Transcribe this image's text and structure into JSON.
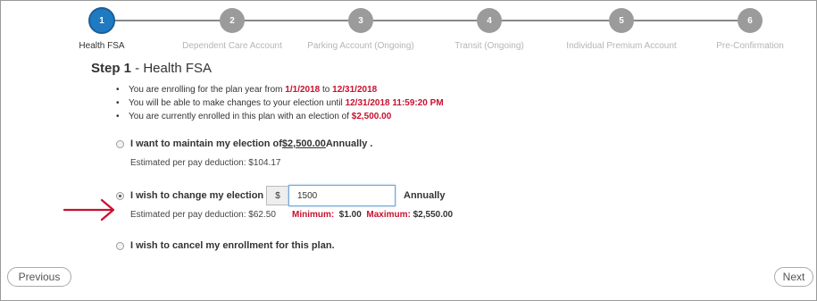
{
  "stepper": {
    "steps": [
      {
        "number": "1",
        "label": "Health FSA",
        "active": true
      },
      {
        "number": "2",
        "label": "Dependent Care Account",
        "active": false
      },
      {
        "number": "3",
        "label": "Parking Account (Ongoing)",
        "active": false
      },
      {
        "number": "4",
        "label": "Transit (Ongoing)",
        "active": false
      },
      {
        "number": "5",
        "label": "Individual Premium Account",
        "active": false
      },
      {
        "number": "6",
        "label": "Pre-Confirmation",
        "active": false
      }
    ]
  },
  "heading": {
    "step": "Step 1",
    "title": " - Health FSA"
  },
  "info": {
    "line1_prefix": "You are enrolling for the plan year from ",
    "line1_start": "1/1/2018",
    "line1_mid": " to ",
    "line1_end": "12/31/2018",
    "line2_prefix": "You will be able to make changes to your election until ",
    "line2_date": "12/31/2018 11:59:20 PM",
    "line3_prefix": "You are currently enrolled in this plan with an election of ",
    "line3_amount": "$2,500.00"
  },
  "option_maintain": {
    "prefix": "I want to maintain my election of ",
    "amount": "$2,500.00",
    "suffix": " Annually .",
    "estimate": "Estimated per pay deduction: $104.17",
    "selected": false
  },
  "option_change": {
    "label": "I wish to change my election amount to",
    "currency": "$",
    "value": "1500",
    "annually": "Annually",
    "estimate": "Estimated per pay deduction: $62.50",
    "min_label": "Minimum:",
    "min_value": "$1.00",
    "max_label": "Maximum:",
    "max_value": "$2,550.00",
    "selected": true
  },
  "option_cancel": {
    "label": "I wish to cancel my enrollment for this plan.",
    "selected": false
  },
  "nav": {
    "previous": "Previous",
    "next": "Next"
  },
  "colors": {
    "accent": "#1f7ac2",
    "emphasis": "#c8102e",
    "arrow": "#c8102e",
    "inactive": "#9b9b9b"
  },
  "icons": {
    "annotation": "arrow-right-icon"
  }
}
